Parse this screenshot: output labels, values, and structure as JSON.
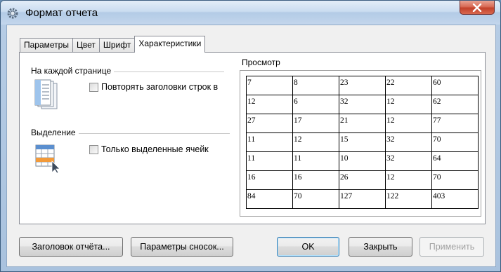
{
  "window": {
    "title": "Формат отчета"
  },
  "tabs": [
    {
      "label": "Параметры"
    },
    {
      "label": "Цвет"
    },
    {
      "label": "Шрифт"
    },
    {
      "label": "Характеристики"
    }
  ],
  "groups": {
    "each_page": {
      "title": "На каждой странице",
      "checkbox_label": "Повторять заголовки строк в",
      "checked": false
    },
    "selection": {
      "title": "Выделение",
      "checkbox_label": "Только выделенные ячейк",
      "checked": false
    }
  },
  "preview": {
    "title": "Просмотр",
    "rows": [
      [
        "7",
        "8",
        "23",
        "22",
        "60"
      ],
      [
        "12",
        "6",
        "32",
        "12",
        "62"
      ],
      [
        "27",
        "17",
        "21",
        "12",
        "77"
      ],
      [
        "11",
        "12",
        "15",
        "32",
        "70"
      ],
      [
        "11",
        "11",
        "10",
        "32",
        "64"
      ],
      [
        "16",
        "16",
        "26",
        "12",
        "70"
      ],
      [
        "84",
        "70",
        "127",
        "122",
        "403"
      ]
    ]
  },
  "buttons": {
    "report_header": "Заголовок отчёта...",
    "footnote_params": "Параметры сносок...",
    "ok": "OK",
    "close": "Закрыть",
    "apply": "Применить"
  }
}
